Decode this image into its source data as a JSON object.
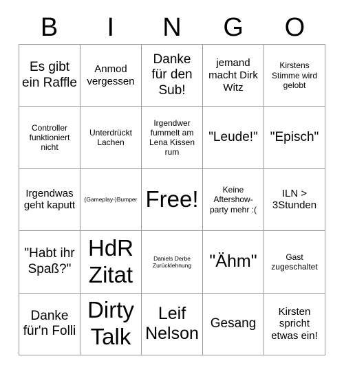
{
  "header": {
    "letters": [
      "B",
      "I",
      "N",
      "G",
      "O"
    ]
  },
  "grid": {
    "columns": 5,
    "rows": 5,
    "cells": [
      {
        "text": "Es gibt ein Raffle",
        "size": "l"
      },
      {
        "text": "Anmod vergessen",
        "size": "m"
      },
      {
        "text": "Danke für den Sub!",
        "size": "l"
      },
      {
        "text": "jemand macht Dirk Witz",
        "size": "m"
      },
      {
        "text": "Kirstens Stimme wird gelobt",
        "size": "s"
      },
      {
        "text": "Controller funktioniert nicht",
        "size": "s"
      },
      {
        "text": "Unterdrückt Lachen",
        "size": "s"
      },
      {
        "text": "Irgendwer fummelt am Lena Kissen rum",
        "size": "s"
      },
      {
        "text": "\"Leude!\"",
        "size": "l"
      },
      {
        "text": "\"Episch\"",
        "size": "l"
      },
      {
        "text": "Irgendwas geht kaputt",
        "size": "m"
      },
      {
        "text": "(Gameplay-)Bumper",
        "size": "xs"
      },
      {
        "text": "Free!",
        "size": "xxl"
      },
      {
        "text": "Keine Aftershow-party mehr :(",
        "size": "s"
      },
      {
        "text": "ILN > 3Stunden",
        "size": "m"
      },
      {
        "text": "\"Habt ihr Spaß?\"",
        "size": "l"
      },
      {
        "text": "HdR Zitat",
        "size": "xxl"
      },
      {
        "text": "Daniels Derbe Zurücklehnung",
        "size": "xs"
      },
      {
        "text": "\"Ähm\"",
        "size": "xl"
      },
      {
        "text": "Gast zugeschaltet",
        "size": "s"
      },
      {
        "text": "Danke für'n Folli",
        "size": "l"
      },
      {
        "text": "Dirty Talk",
        "size": "xxl"
      },
      {
        "text": "Leif Nelson",
        "size": "xl"
      },
      {
        "text": "Gesang",
        "size": "l"
      },
      {
        "text": "Kirsten spricht etwas ein!",
        "size": "m"
      }
    ]
  },
  "colors": {
    "background": "#ffffff",
    "grid_line": "#999999",
    "text": "#000000"
  }
}
